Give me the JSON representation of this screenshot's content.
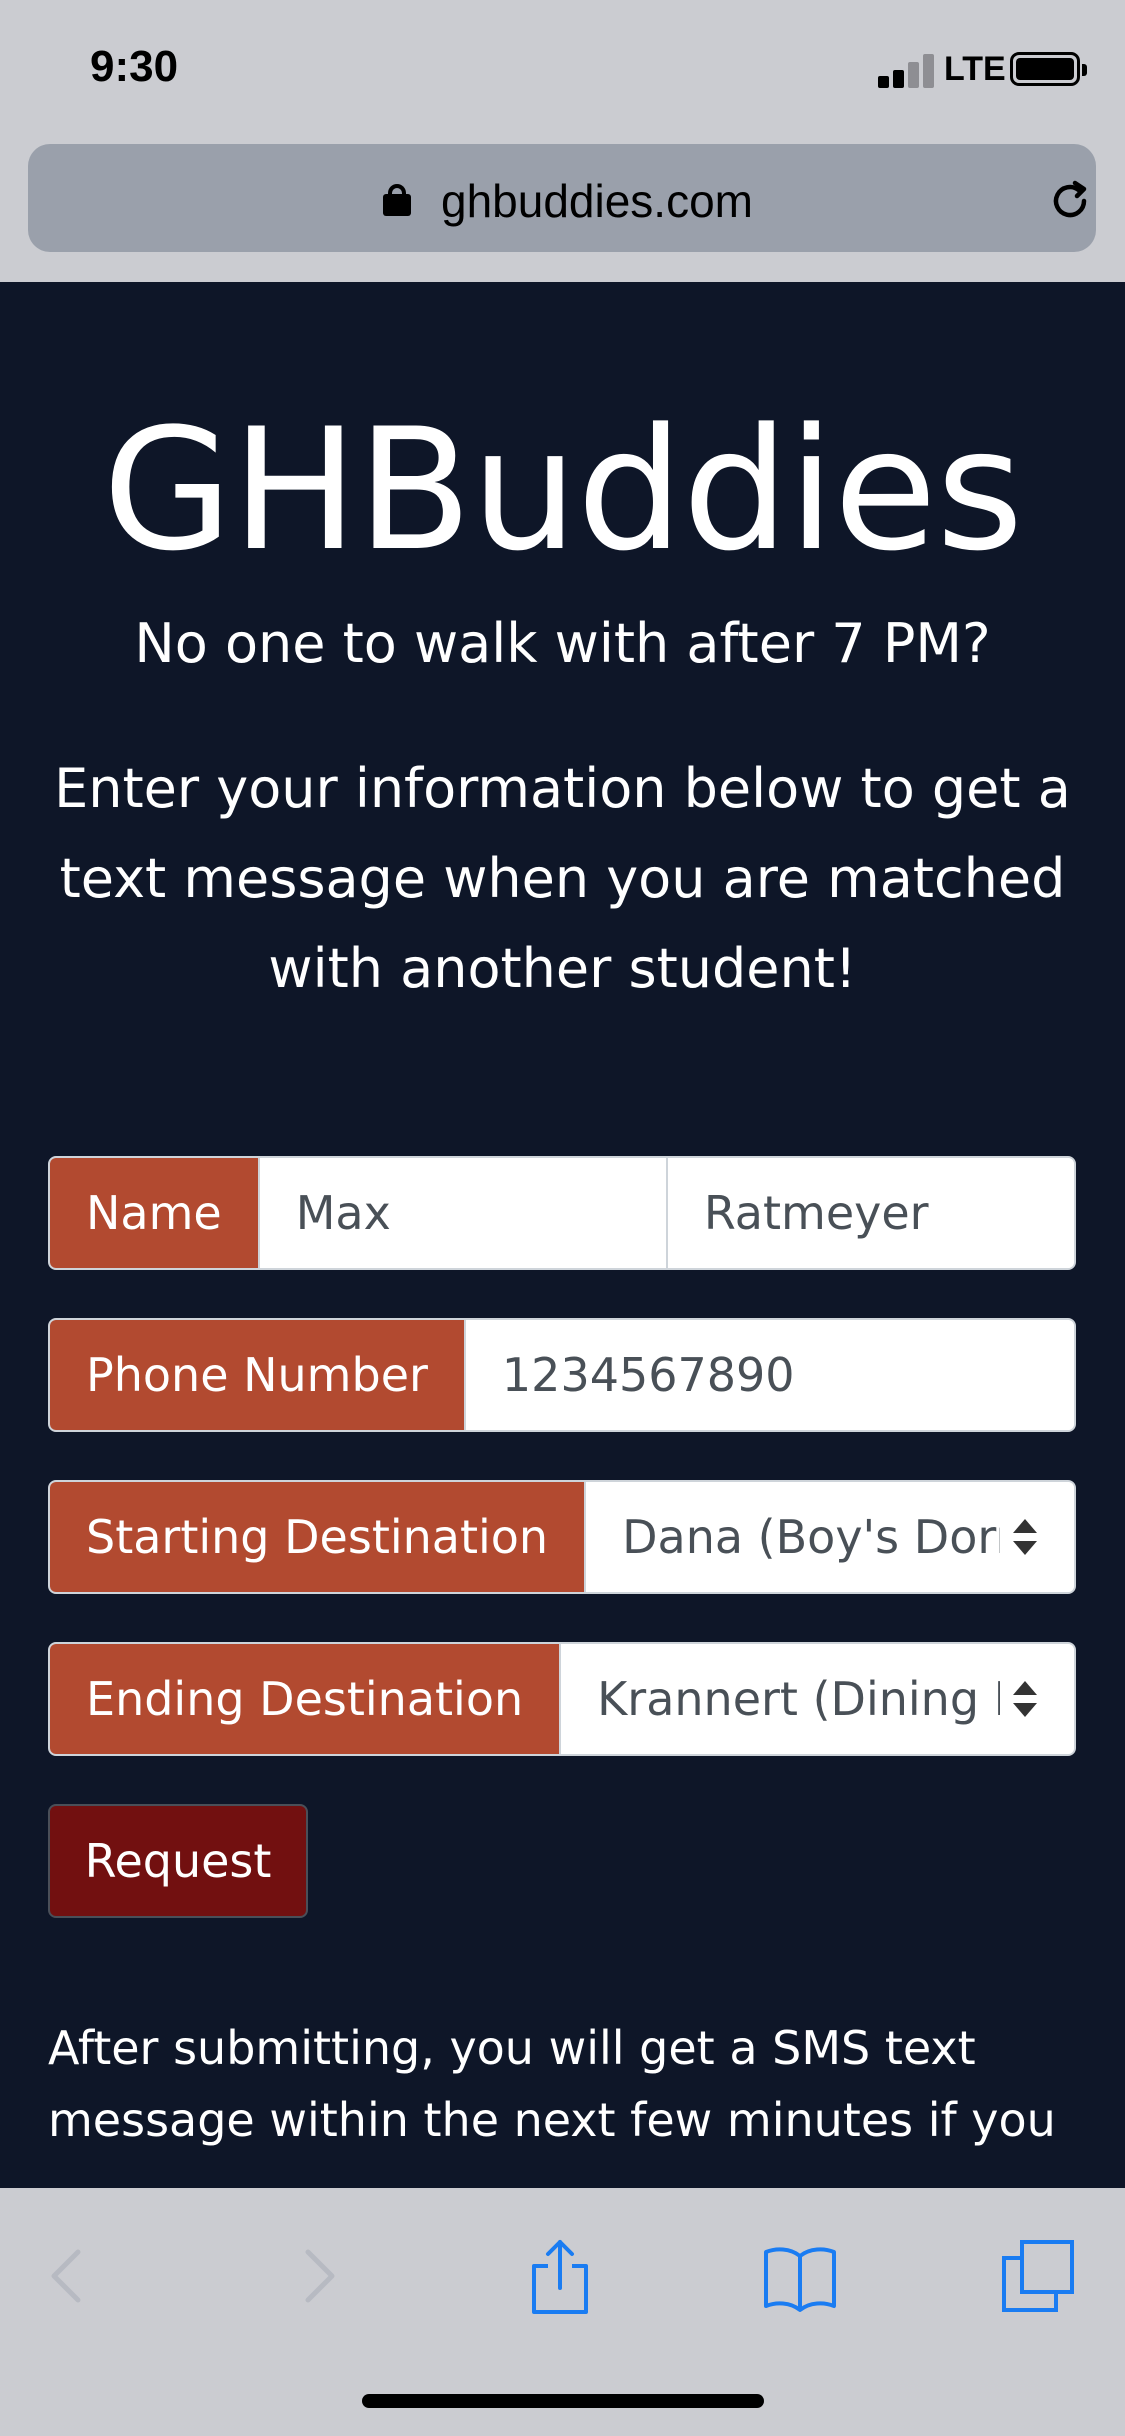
{
  "status_bar": {
    "time": "9:30",
    "network": "LTE"
  },
  "browser": {
    "url": "ghbuddies.com",
    "icons": [
      "lock-icon",
      "reload-icon",
      "back-icon",
      "forward-icon",
      "share-icon",
      "bookmarks-icon",
      "tabs-icon"
    ]
  },
  "page": {
    "title": "GHBuddies",
    "lead": "No one to walk with after 7 PM?",
    "intro": "Enter your information below to get a text message when you are matched with another student!",
    "form": {
      "name_label": "Name",
      "first_name_value": "Max",
      "last_name_value": "Ratmeyer",
      "phone_label": "Phone Number",
      "phone_value": "1234567890",
      "start_label": "Starting Destination",
      "start_value": "Dana (Boy's Dorm",
      "end_label": "Ending Destination",
      "end_value": "Krannert (Dining H",
      "submit_label": "Request"
    },
    "after_text": "After submitting, you will get a SMS text message within the next few minutes if you"
  },
  "colors": {
    "background": "#0e1628",
    "addon": "#b24a30",
    "button": "#721010",
    "browser_chrome": "#cbccd1",
    "toolbar_icon": "#1a7cf2"
  }
}
